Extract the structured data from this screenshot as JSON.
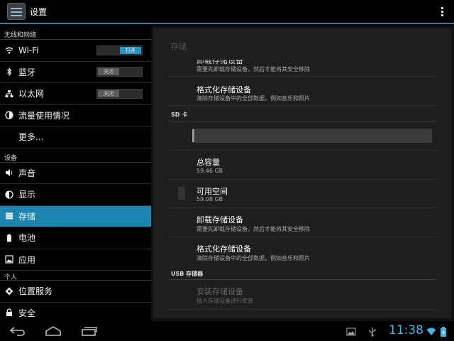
{
  "actionbar": {
    "title": "设置"
  },
  "sidebar": {
    "sections": [
      {
        "header": "无线和网络"
      },
      {
        "header": "设备"
      },
      {
        "header": "个人"
      }
    ],
    "items": [
      {
        "label": "Wi-Fi",
        "icon": "wifi-icon",
        "toggle": "打开",
        "toggle_state": "on"
      },
      {
        "label": "蓝牙",
        "icon": "bluetooth-icon",
        "toggle": "关闭",
        "toggle_state": "off"
      },
      {
        "label": "以太网",
        "icon": "ethernet-icon",
        "toggle": "关闭",
        "toggle_state": "off"
      },
      {
        "label": "流量使用情况",
        "icon": "data-usage-icon"
      },
      {
        "label": "更多..."
      },
      {
        "label": "声音",
        "icon": "sound-icon"
      },
      {
        "label": "显示",
        "icon": "display-icon"
      },
      {
        "label": "存储",
        "icon": "storage-icon",
        "selected": true
      },
      {
        "label": "电池",
        "icon": "battery-icon"
      },
      {
        "label": "应用",
        "icon": "apps-icon"
      },
      {
        "label": "位置服务",
        "icon": "location-icon"
      },
      {
        "label": "安全",
        "icon": "security-icon"
      }
    ]
  },
  "storage": {
    "title": "存储",
    "internal": {
      "unmount": {
        "title": "卸载存储设备",
        "summary": "需要先卸载存储设备，然后才能将其安全移除"
      },
      "format": {
        "title": "格式化存储设备",
        "summary": "清除存储设备中的全部数据，例如音乐和照片"
      }
    },
    "sd_card": {
      "header": "SD 卡",
      "total": {
        "title": "总容量",
        "value": "59.46 GB"
      },
      "available": {
        "title": "可用空间",
        "value": "59.08 GB"
      },
      "unmount": {
        "title": "卸载存储设备",
        "summary": "需要先卸载存储设备，然后才能将其安全移除"
      },
      "format": {
        "title": "格式化存储设备",
        "summary": "清除存储设备中的全部数据，例如音乐和照片"
      }
    },
    "usb": {
      "header": "USB 存储器",
      "mount": {
        "title": "安装存储设备",
        "summary": "插入存储设备进行安装"
      }
    }
  },
  "statusbar": {
    "time": "11:38"
  },
  "colors": {
    "accent": "#1c86b0",
    "clock": "#3fb6e6",
    "toggle_on": "#2a95c5"
  }
}
